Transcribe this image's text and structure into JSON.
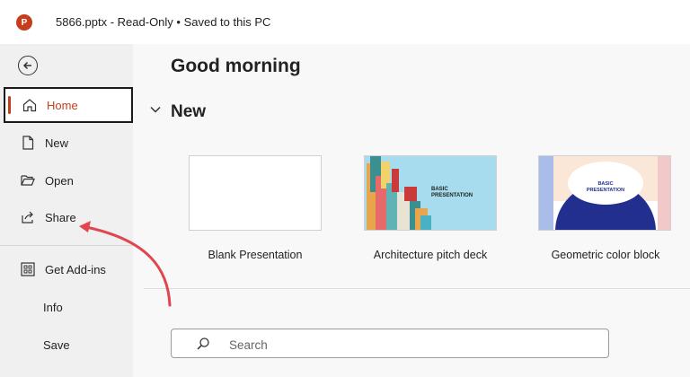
{
  "app": {
    "logo_letter": "P",
    "title": "5866.pptx  -  Read-Only • Saved to this PC"
  },
  "sidebar": {
    "items": [
      {
        "label": "Home",
        "icon": "home-icon"
      },
      {
        "label": "New",
        "icon": "new-file-icon"
      },
      {
        "label": "Open",
        "icon": "folder-open-icon"
      },
      {
        "label": "Share",
        "icon": "share-icon"
      },
      {
        "label": "Get Add-ins",
        "icon": "add-ins-grid-icon"
      },
      {
        "label": "Info"
      },
      {
        "label": "Save"
      }
    ]
  },
  "main": {
    "greeting": "Good morning",
    "new_section": {
      "title": "New"
    },
    "templates": [
      {
        "label": "Blank Presentation"
      },
      {
        "label": "Architecture pitch deck",
        "thumb_text": "BASIC PRESENTATION"
      },
      {
        "label": "Geometric color block",
        "thumb_text": "BASIC PRESENTATION"
      }
    ],
    "search": {
      "placeholder": "Search"
    }
  },
  "colors": {
    "accent": "#c43e1c",
    "annotation_arrow": "#e0464f"
  }
}
